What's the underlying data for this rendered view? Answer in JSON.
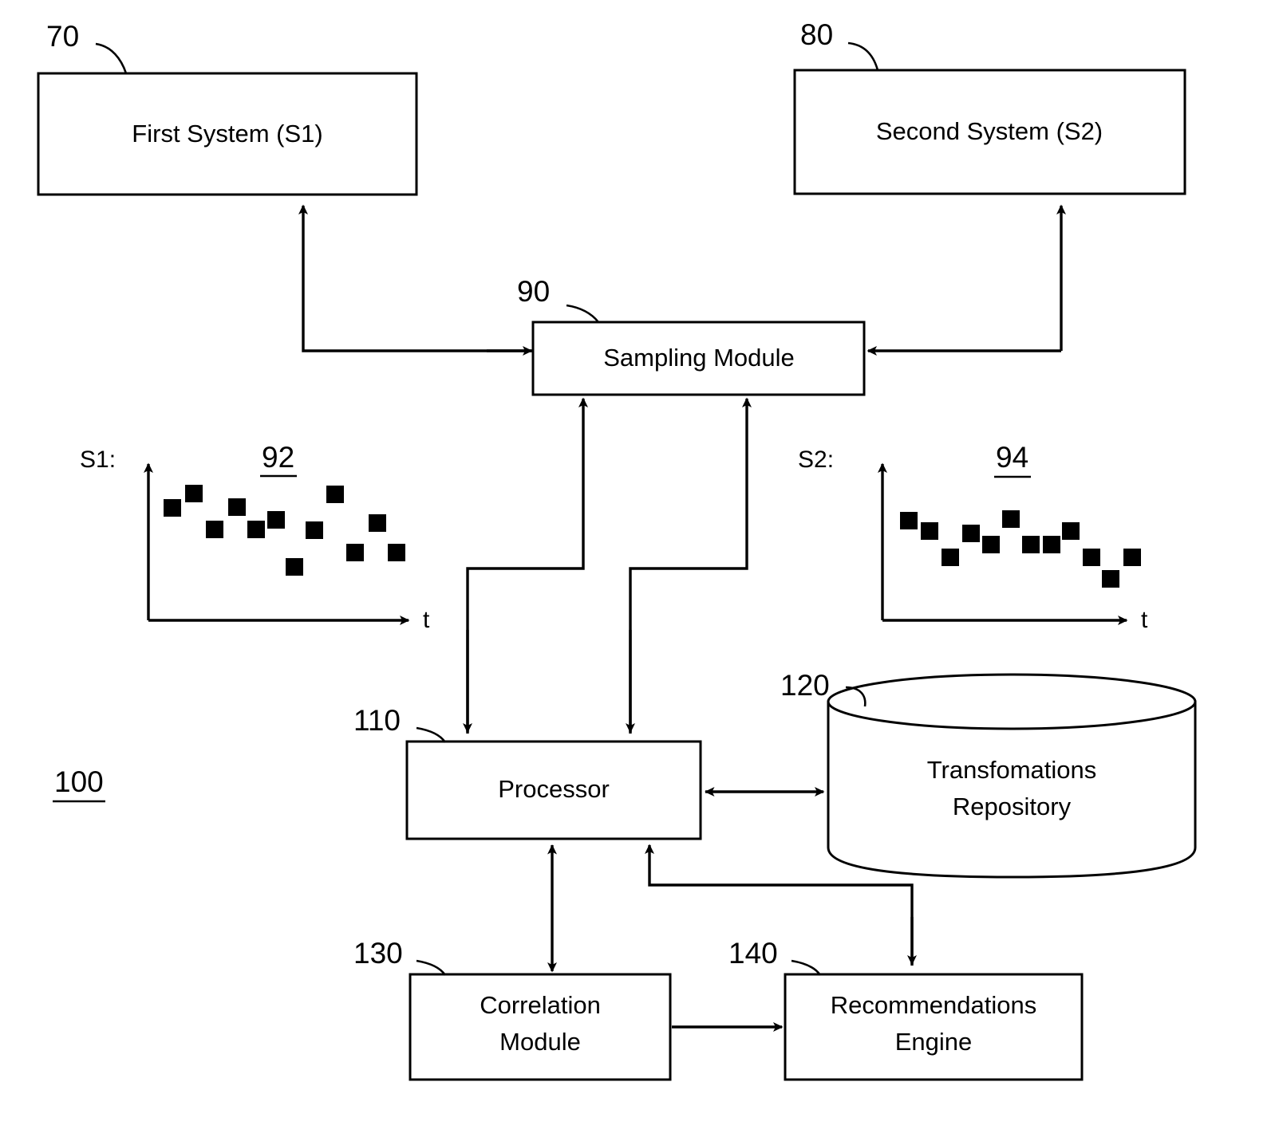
{
  "figure": {
    "overall_ref": "100",
    "nodes": [
      {
        "id": "first-system",
        "ref": "70",
        "label": "First System (S1)"
      },
      {
        "id": "second-system",
        "ref": "80",
        "label": "Second System (S2)"
      },
      {
        "id": "sampling-module",
        "ref": "90",
        "label": "Sampling Module"
      },
      {
        "id": "processor",
        "ref": "110",
        "label": "Processor"
      },
      {
        "id": "transformations-repository",
        "ref": "120",
        "label_line1": "Transfomations",
        "label_line2": "Repository"
      },
      {
        "id": "correlation-module",
        "ref": "130",
        "label_line1": "Correlation",
        "label_line2": "Module"
      },
      {
        "id": "recommendations-engine",
        "ref": "140",
        "label_line1": "Recommendations",
        "label_line2": "Engine"
      }
    ],
    "plots": [
      {
        "id": "s1-plot",
        "ref": "92",
        "series_label": "S1:",
        "axis_x_label": "t"
      },
      {
        "id": "s2-plot",
        "ref": "94",
        "series_label": "S2:",
        "axis_x_label": "t"
      }
    ]
  },
  "chart_data": [
    {
      "type": "scatter",
      "id": "s1-plot",
      "title": "92",
      "ylabel": "S1",
      "xlabel": "t",
      "marker": "filled-square",
      "xlim": [
        0,
        12
      ],
      "ylim": [
        0,
        10
      ],
      "x": [
        1,
        1.8,
        3.0,
        3.9,
        4.8,
        5.6,
        6.6,
        7.6,
        8.6,
        9.4,
        10.4,
        11.2
      ],
      "y": [
        7.4,
        8.2,
        6.2,
        7.6,
        6.2,
        6.9,
        4.4,
        6.3,
        8.0,
        5.1,
        6.9,
        5.0
      ]
    },
    {
      "type": "scatter",
      "id": "s2-plot",
      "title": "94",
      "ylabel": "S2",
      "xlabel": "t",
      "marker": "filled-square",
      "xlim": [
        0,
        12
      ],
      "ylim": [
        0,
        10
      ],
      "x": [
        1.0,
        1.9,
        2.9,
        3.8,
        4.6,
        5.6,
        6.5,
        7.3,
        8.2,
        9.1,
        9.9,
        10.8
      ],
      "y": [
        7.7,
        7.3,
        5.7,
        7.2,
        6.6,
        8.0,
        6.6,
        6.6,
        7.3,
        5.7,
        4.7,
        5.7
      ]
    }
  ],
  "colors": {
    "stroke": "#000000",
    "fill": "#ffffff"
  }
}
